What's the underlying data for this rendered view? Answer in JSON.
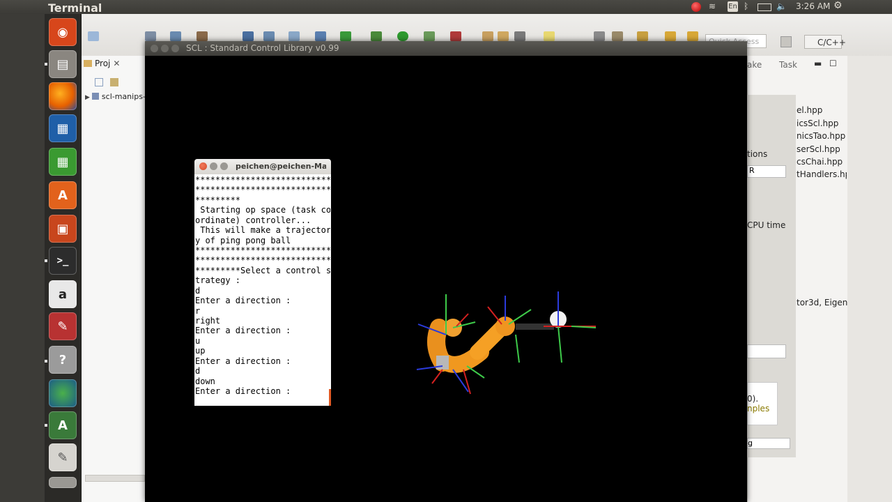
{
  "top_panel": {
    "app_name": "Terminal",
    "language": "En",
    "clock": "3:26 AM",
    "volume_icon": "speaker-icon",
    "battery_icon": "battery-icon",
    "network_icon": "wifi-icon",
    "bluetooth_icon": "bluetooth-icon",
    "settings_icon": "gear-icon"
  },
  "launcher": {
    "items": [
      {
        "name": "ubuntu-dash-icon",
        "color": "#d7461b"
      },
      {
        "name": "files-icon",
        "color": "#8a8680"
      },
      {
        "name": "firefox-icon",
        "color": "#e66000"
      },
      {
        "name": "writer-icon",
        "color": "#1f5fa8"
      },
      {
        "name": "calc-icon",
        "color": "#3a9a31"
      },
      {
        "name": "software-center-icon",
        "color": "#e2621c"
      },
      {
        "name": "impress-icon",
        "color": "#c8461d"
      },
      {
        "name": "terminal-icon",
        "color": "#2c2c2c"
      },
      {
        "name": "amazon-icon",
        "color": "#e0e0e0"
      },
      {
        "name": "system-settings-icon",
        "color": "#b83232"
      },
      {
        "name": "help-icon",
        "color": "#9b9b9b"
      },
      {
        "name": "globe-icon",
        "color": "#2d8c3f"
      },
      {
        "name": "updater-icon",
        "color": "#3a7a3a"
      },
      {
        "name": "text-editor-icon",
        "color": "#d6d4cf"
      },
      {
        "name": "trash-icon",
        "color": "#9a9893"
      }
    ]
  },
  "eclipse": {
    "quick_access_placeholder": "Quick Access",
    "perspective": "C/C++",
    "left_tab": "Proj",
    "project_item": "scl-manips-",
    "right_tabs": [
      "ake",
      "Task"
    ],
    "right_files": [
      "el.hpp",
      "icsScl.hpp",
      "nicsTao.hpp",
      "serScl.hpp",
      "csChai.hpp",
      "tHandlers.hp"
    ],
    "fragments": {
      "options": "tions",
      "dropdown": "R",
      "cpu_time": "CPU time",
      "vector": "tor3d, Eigen:",
      "paren": "0).",
      "samples": "nples",
      "bottom": "g"
    }
  },
  "scl_window": {
    "title": "SCL : Standard Control Library v0.99"
  },
  "terminal": {
    "title": "peichen@peichen-Mac",
    "lines": [
      "****************************",
      "****************************",
      "*********",
      " Starting op space (task co",
      "ordinate) controller...",
      " This will make a trajector",
      "y of ping pong ball",
      "****************************",
      "****************************",
      "*********Select a control s",
      "trategy :",
      "d",
      "Enter a direction :",
      "r",
      "right",
      "Enter a direction :",
      "u",
      "up",
      "Enter a direction :",
      "d",
      "down",
      "Enter a direction :"
    ]
  }
}
